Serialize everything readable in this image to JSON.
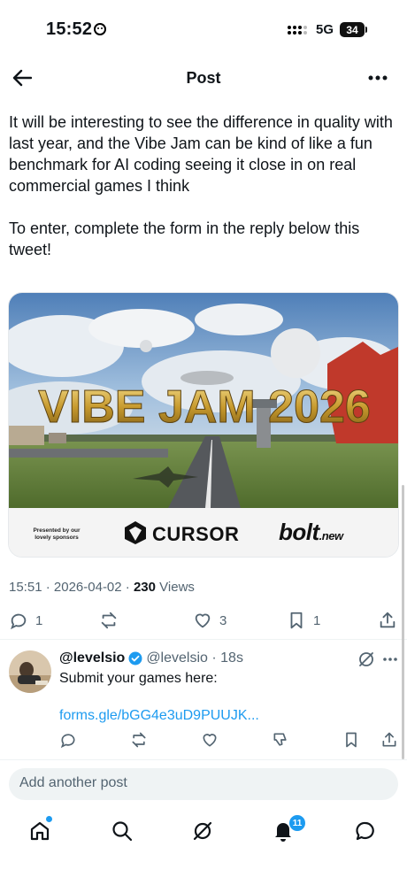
{
  "status": {
    "time": "15:52",
    "network": "5G",
    "battery": "34"
  },
  "header": {
    "title": "Post"
  },
  "post": {
    "paragraph1": "It will be interesting to see the difference in quality with last year, and the Vibe Jam can be kind of like a fun benchmark for AI coding seeing it close in on real commercial games I think",
    "paragraph2": "To enter, complete the form in the reply below this tweet!",
    "media": {
      "headline": "VIBE JAM 2026",
      "presented_by": "Presented by our lovely sponsors",
      "sponsor1": "CURSOR",
      "sponsor2": "bolt",
      "sponsor2_suffix": ".new"
    },
    "time": "15:51",
    "date": "2026-04-02",
    "views_count": "230",
    "views_label": "Views",
    "replies": "1",
    "likes": "3",
    "bookmarks": "1"
  },
  "reply": {
    "name": "@levelsio",
    "handle": "@levelsio",
    "age": "18s",
    "text": "Submit your games here:",
    "link": "forms.gle/bGG4e3uD9PUUJK..."
  },
  "composer": {
    "placeholder": "Add another post"
  },
  "nav": {
    "notifications_count": "11"
  },
  "colors": {
    "accent": "#1d9bf0",
    "text": "#0f1419",
    "muted": "#536471"
  }
}
